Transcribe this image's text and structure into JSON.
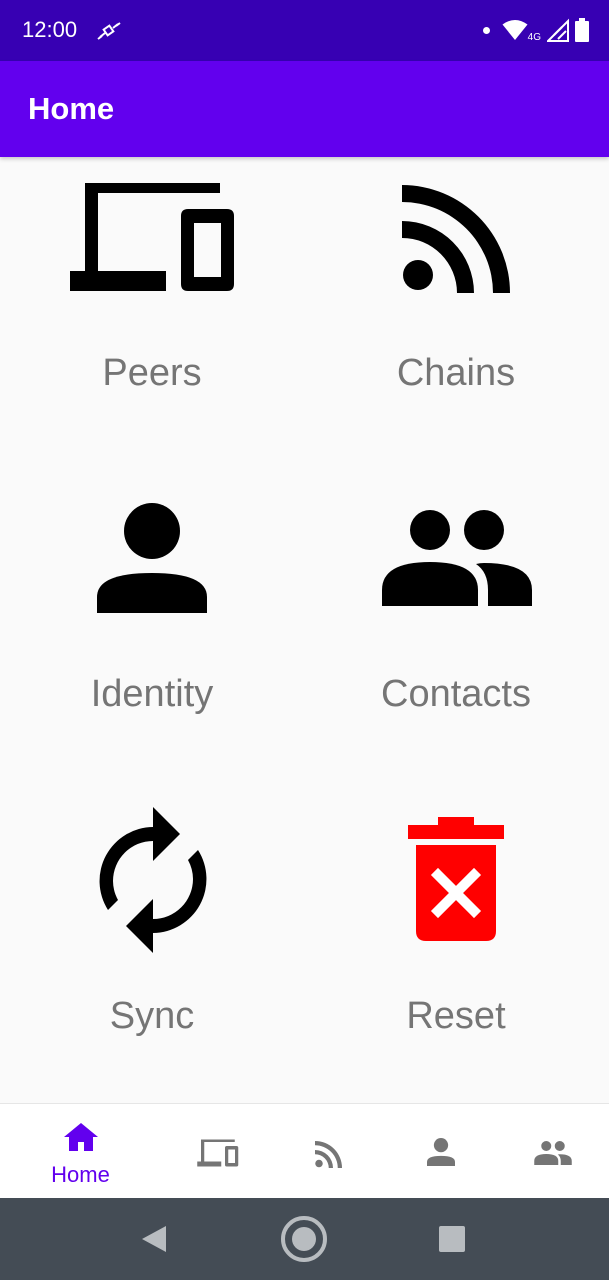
{
  "status_bar": {
    "time": "12:00",
    "network": "4G",
    "icons": [
      "satellite-icon",
      "dot-icon",
      "wifi-icon",
      "signal-icon",
      "battery-icon"
    ]
  },
  "app_bar": {
    "title": "Home"
  },
  "tiles": [
    {
      "label": "Peers",
      "icon": "devices-icon"
    },
    {
      "label": "Chains",
      "icon": "rss-feed-icon"
    },
    {
      "label": "Identity",
      "icon": "person-icon"
    },
    {
      "label": "Contacts",
      "icon": "people-icon"
    },
    {
      "label": "Sync",
      "icon": "sync-icon"
    },
    {
      "label": "Reset",
      "icon": "delete-forever-icon",
      "color": "#ff0000"
    }
  ],
  "bottom_nav": {
    "active_color": "#6200ee",
    "inactive_color": "#757575",
    "items": [
      {
        "label": "Home",
        "icon": "home-icon",
        "active": true
      },
      {
        "icon": "devices-icon",
        "active": false
      },
      {
        "icon": "rss-feed-icon",
        "active": false
      },
      {
        "icon": "person-icon",
        "active": false
      },
      {
        "icon": "people-icon",
        "active": false
      }
    ]
  },
  "system_nav": {
    "buttons": [
      "back-icon",
      "home-circle-icon",
      "recents-icon"
    ]
  },
  "colors": {
    "status_bar": "#3700b3",
    "app_bar": "#6200ee",
    "background": "#fafafa",
    "label_gray": "#757575",
    "reset_red": "#ff0000"
  }
}
